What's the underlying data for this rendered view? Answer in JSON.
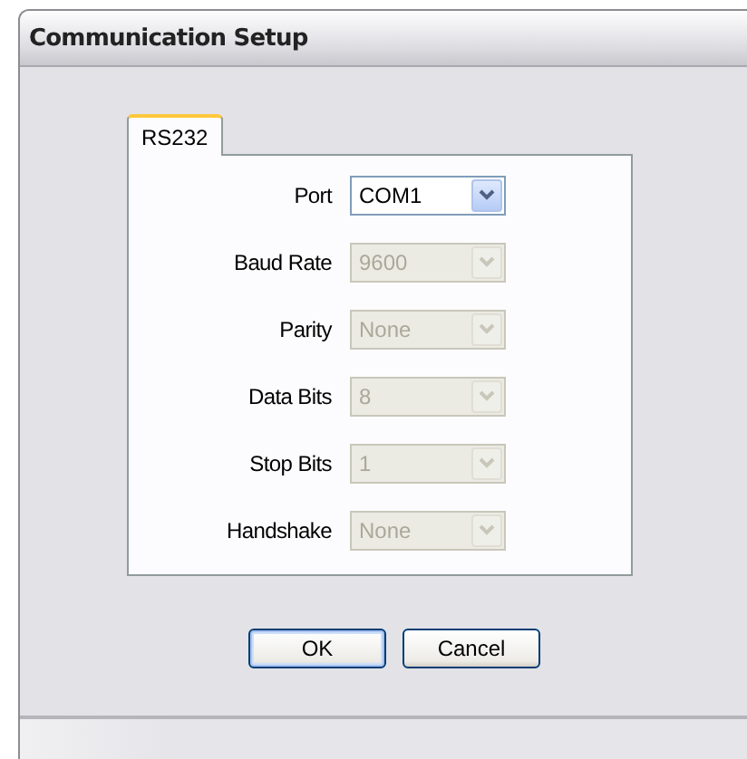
{
  "window": {
    "title": "Communication Setup"
  },
  "tabs": [
    {
      "label": "RS232",
      "selected": true
    }
  ],
  "fields": [
    {
      "label": "Port",
      "value": "COM1",
      "disabled": false
    },
    {
      "label": "Baud Rate",
      "value": "9600",
      "disabled": true
    },
    {
      "label": "Parity",
      "value": "None",
      "disabled": true
    },
    {
      "label": "Data Bits",
      "value": "8",
      "disabled": true
    },
    {
      "label": "Stop Bits",
      "value": "1",
      "disabled": true
    },
    {
      "label": "Handshake",
      "value": "None",
      "disabled": true
    }
  ],
  "buttons": [
    {
      "label": "OK",
      "default": true
    },
    {
      "label": "Cancel",
      "default": false
    }
  ]
}
